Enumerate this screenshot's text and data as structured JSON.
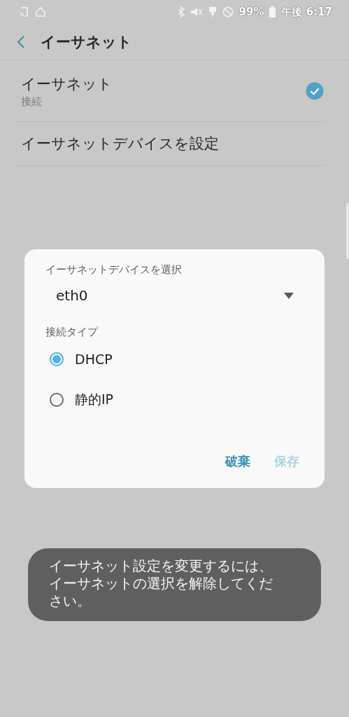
{
  "status_bar": {
    "battery": "99%",
    "time": "午後 6:17"
  },
  "header": {
    "title": "イーサネット"
  },
  "settings": [
    {
      "kind": "toggle",
      "title": "イーサネット",
      "subtitle": "接続",
      "checked": true
    },
    {
      "kind": "link",
      "title": "イーサネットデバイスを設定"
    }
  ],
  "dialog": {
    "device_label": "イーサネットデバイスを選択",
    "device_value": "eth0",
    "type_label": "接続タイプ",
    "options": [
      {
        "label": "DHCP",
        "selected": true
      },
      {
        "label": "静的IP",
        "selected": false
      }
    ],
    "buttons": [
      {
        "label": "破棄",
        "disabled": false
      },
      {
        "label": "保存",
        "disabled": true
      }
    ]
  },
  "toast": {
    "text": "イーサネット設定を変更するには、イーサネットの選択を解除してください。"
  }
}
